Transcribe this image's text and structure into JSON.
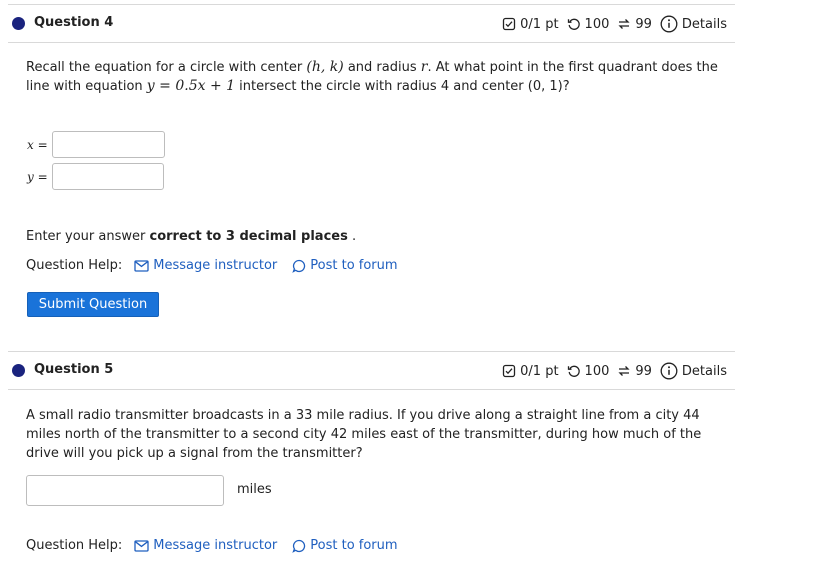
{
  "q4": {
    "title": "Question 4",
    "score": "0/1 pt",
    "retries": "100",
    "attempts": "99",
    "details": "Details",
    "prompt_a": "Recall the equation for a circle with center ",
    "prompt_hk": "(h, k)",
    "prompt_b": " and radius ",
    "prompt_r": "r",
    "prompt_c": ". At what point in the first quadrant does the line with equation ",
    "prompt_eq": "y = 0.5x + 1",
    "prompt_d": " intersect the circle with radius 4 and center (0, 1)?",
    "x_label": "x =",
    "y_label": "y =",
    "x_value": "",
    "y_value": "",
    "instruction_a": "Enter your answer ",
    "instruction_bold": "correct to 3 decimal places",
    "instruction_b": " .",
    "help_label": "Question Help:",
    "message_link": "Message instructor",
    "forum_link": "Post to forum",
    "submit_label": "Submit Question"
  },
  "q5": {
    "title": "Question 5",
    "score": "0/1 pt",
    "retries": "100",
    "attempts": "99",
    "details": "Details",
    "prompt": "A small radio transmitter broadcasts in a 33 mile radius. If you drive along a straight line from a city 44 miles north of the transmitter to a second city 42 miles east of the transmitter, during how much of the drive will you pick up a signal from the transmitter?",
    "answer_value": "",
    "unit": "miles",
    "help_label": "Question Help:",
    "message_link": "Message instructor",
    "forum_link": "Post to forum"
  },
  "colors": {
    "accent": "#1a73d9",
    "link": "#1f5fbf",
    "dot": "#1a237e"
  }
}
